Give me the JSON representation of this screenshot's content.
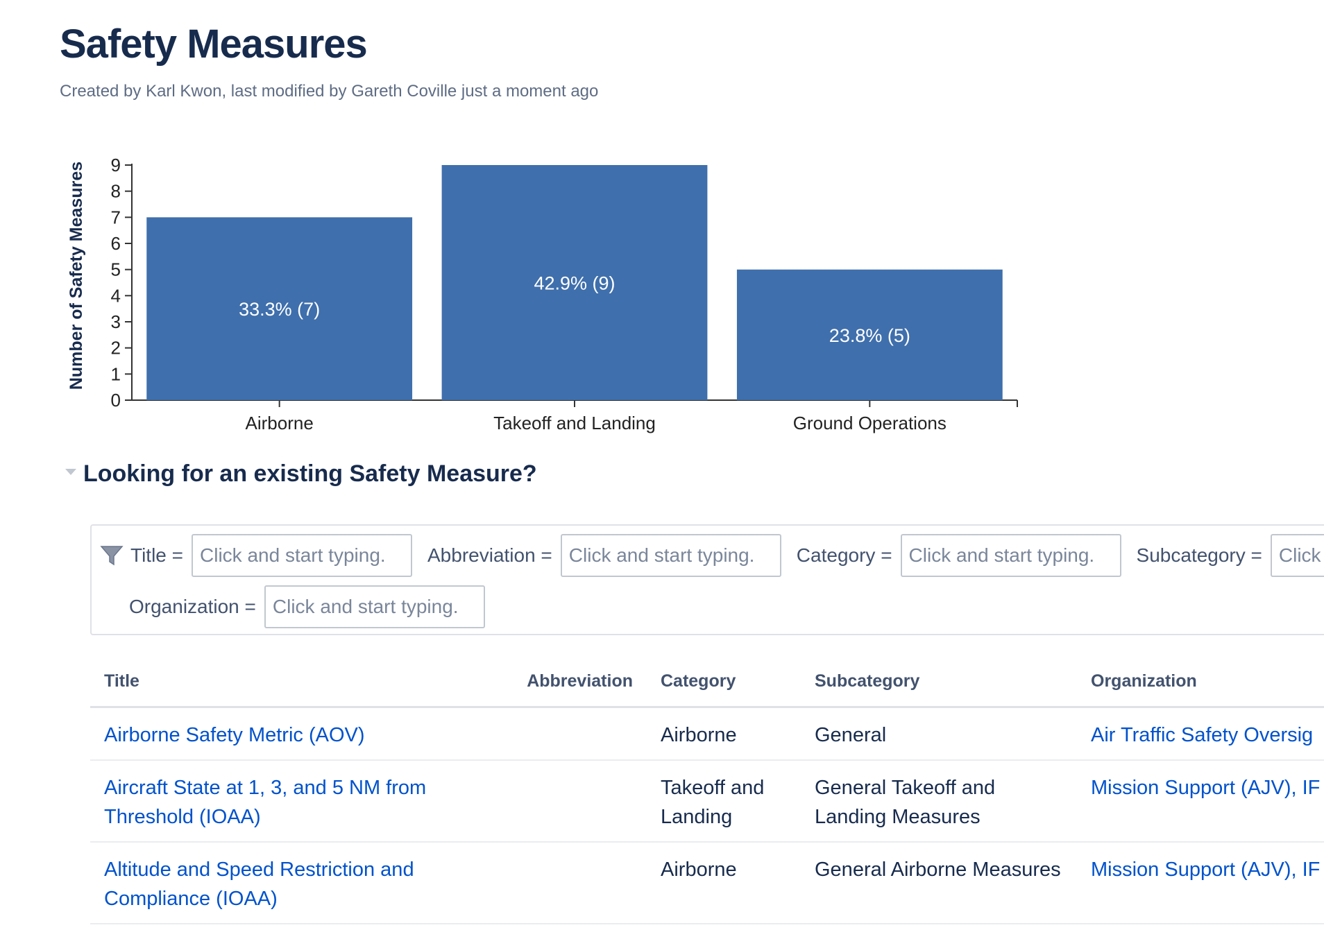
{
  "page": {
    "title": "Safety Measures",
    "byline": "Created by Karl Kwon, last modified by Gareth Coville just a moment ago"
  },
  "chart_data": {
    "type": "bar",
    "title": "",
    "xlabel": "",
    "ylabel": "Number of Safety Measures",
    "categories": [
      "Airborne",
      "Takeoff and Landing",
      "Ground Operations"
    ],
    "values": [
      7,
      9,
      5
    ],
    "data_labels": [
      "33.3% (7)",
      "42.9% (9)",
      "23.8% (5)"
    ],
    "ylim": [
      0,
      9
    ],
    "yticks": [
      0,
      1,
      2,
      3,
      4,
      5,
      6,
      7,
      8,
      9
    ],
    "bar_color": "#3f6fac",
    "label_color": "#ffffff",
    "grid": false,
    "legend": "none"
  },
  "section": {
    "heading": "Looking for an existing Safety Measure?"
  },
  "filters": {
    "icon": "filter-icon",
    "items": [
      {
        "label": "Title =",
        "placeholder": "Click and start typing."
      },
      {
        "label": "Abbreviation =",
        "placeholder": "Click and start typing."
      },
      {
        "label": "Category =",
        "placeholder": "Click and start typing."
      },
      {
        "label": "Subcategory =",
        "placeholder": "Click and start typing."
      },
      {
        "label": "Organization =",
        "placeholder": "Click and start typing."
      }
    ]
  },
  "table": {
    "headers": [
      "Title",
      "Abbreviation",
      "Category",
      "Subcategory",
      "Organization"
    ],
    "rows": [
      {
        "title": "Airborne Safety Metric (AOV)",
        "abbreviation": "",
        "category": "Airborne",
        "subcategory": "General",
        "organization": "Air Traffic Safety Oversig"
      },
      {
        "title": "Aircraft State at 1, 3, and 5 NM from Threshold (IOAA)",
        "abbreviation": "",
        "category": "Takeoff and Landing",
        "subcategory": "General Takeoff and Landing Measures",
        "organization": "Mission Support (AJV), IF"
      },
      {
        "title": "Altitude and Speed Restriction and Compliance (IOAA)",
        "abbreviation": "",
        "category": "Airborne",
        "subcategory": "General Airborne Measures",
        "organization": "Mission Support (AJV), IF"
      }
    ]
  },
  "colors": {
    "heading": "#172b4d",
    "link": "#0052cc",
    "muted": "#5e6c84",
    "border": "#dfe1e6"
  }
}
